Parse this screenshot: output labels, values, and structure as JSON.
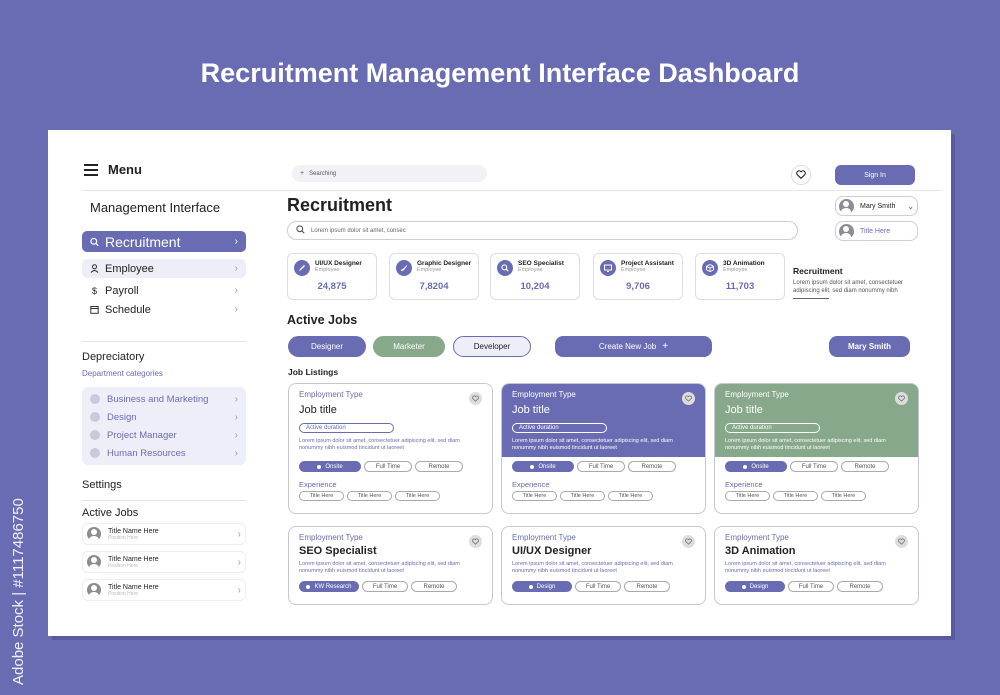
{
  "page_title": "Recruitment Management Interface Dashboard",
  "watermark": "Adobe Stock | #1117486750",
  "colors": {
    "accent": "#6a6cb3",
    "green": "#87a88b",
    "background": "#6a6cb3"
  },
  "sidebar": {
    "menu_label": "Menu",
    "section_title": "Management Interface",
    "active_item": "Recruitment",
    "items": [
      {
        "label": "Employee",
        "icon": "user-icon"
      },
      {
        "label": "Payroll",
        "icon": "dollar-icon"
      },
      {
        "label": "Schedule",
        "icon": "calendar-icon"
      }
    ],
    "depreciatory": {
      "title": "Depreciatory",
      "subtitle": "Department categories",
      "items": [
        "Business and Marketing",
        "Design",
        "Project Manager",
        "Human Resources"
      ]
    },
    "settings_label": "Settings",
    "active_jobs": {
      "title": "Active Jobs",
      "items": [
        {
          "title": "Title Name Here",
          "subtitle": "Position Here"
        },
        {
          "title": "Title Name Here",
          "subtitle": "Position Here"
        },
        {
          "title": "Title Name Here",
          "subtitle": "Position Here"
        }
      ]
    }
  },
  "header": {
    "search_placeholder": "Searching",
    "sign_in_label": "Sign In",
    "user_name": "Mary Smith",
    "title_pill": "Title Here"
  },
  "main": {
    "title": "Recruitment",
    "search_placeholder": "Lorem ipsum dolor sit amet, consec",
    "stats": [
      {
        "title": "UI/UX Designer",
        "sub": "Employee",
        "value": "24,875",
        "icon": "pen-icon"
      },
      {
        "title": "Graphic Designer",
        "sub": "Employee",
        "value": "7,8204",
        "icon": "brush-icon"
      },
      {
        "title": "SEO Specialist",
        "sub": "Employee",
        "value": "10,204",
        "icon": "search-icon"
      },
      {
        "title": "Project Assistant",
        "sub": "Employee",
        "value": "9,706",
        "icon": "monitor-icon"
      },
      {
        "title": "3D Animation",
        "sub": "Employee",
        "value": "11,703",
        "icon": "cube-icon"
      }
    ],
    "info": {
      "title": "Recruitment",
      "text": "Lorem ipsum dolor sit amet, consectetuer adipiscing elit, sed diam nonummy nibh"
    },
    "active_jobs_title": "Active Jobs",
    "filters": [
      "Designer",
      "Marketer",
      "Developer"
    ],
    "create_job_label": "Create New Job",
    "user_chip": "Mary Smith",
    "job_listings_title": "Job Listings",
    "jobs_top": [
      {
        "type": "Employment Type",
        "title": "Job title",
        "duration": "Active duration",
        "desc": "Lorem ipsum dolor sit amet, consectetuer adipiscing elit, sed diam nonummy nibh euismod tincidunt ut laoreet",
        "tags": [
          "Onsite",
          "Full Time",
          "Remote"
        ],
        "exp_label": "Experience",
        "exp_tags": [
          "Title Here",
          "Title Here",
          "Title Here"
        ]
      },
      {
        "type": "Employment Type",
        "title": "Job title",
        "duration": "Active duration",
        "desc": "Lorem ipsum dolor sit amet, consectetuer adipiscing elit, sed diam nonummy nibh euismod tincidunt ut laoreet",
        "tags": [
          "Onsite",
          "Full Time",
          "Remote"
        ],
        "exp_label": "Experience",
        "exp_tags": [
          "Title Here",
          "Title Here",
          "Title Here"
        ]
      },
      {
        "type": "Employment Type",
        "title": "Job title",
        "duration": "Active duration",
        "desc": "Lorem ipsum dolor sit amet, consectetuer adipiscing elit, sed diam nonummy nibh euismod tincidunt ut laoreet",
        "tags": [
          "Onsite",
          "Full Time",
          "Remote"
        ],
        "exp_label": "Experience",
        "exp_tags": [
          "Title Here",
          "Title Here",
          "Title Here"
        ]
      }
    ],
    "jobs_bottom": [
      {
        "type": "Employment Type",
        "title": "SEO Specialist",
        "desc": "Lorem ipsum dolor sit amet, consectetuer adipiscing elit, sed diam nonummy nibh euismod tincidunt ut laoreet",
        "tags": [
          "KW Research",
          "Full Time",
          "Remote"
        ]
      },
      {
        "type": "Employment Type",
        "title": "UI/UX Designer",
        "desc": "Lorem ipsum dolor sit amet, consectetuer adipiscing elit, sed diam nonummy nibh euismod tincidunt ut laoreet",
        "tags": [
          "Design",
          "Full Time",
          "Remote"
        ]
      },
      {
        "type": "Employment Type",
        "title": "3D Animation",
        "desc": "Lorem ipsum dolor sit amet, consectetuer adipiscing elit, sed diam nonummy nibh euismod tincidunt ut laoreet",
        "tags": [
          "Design",
          "Full Time",
          "Remote"
        ]
      }
    ]
  }
}
